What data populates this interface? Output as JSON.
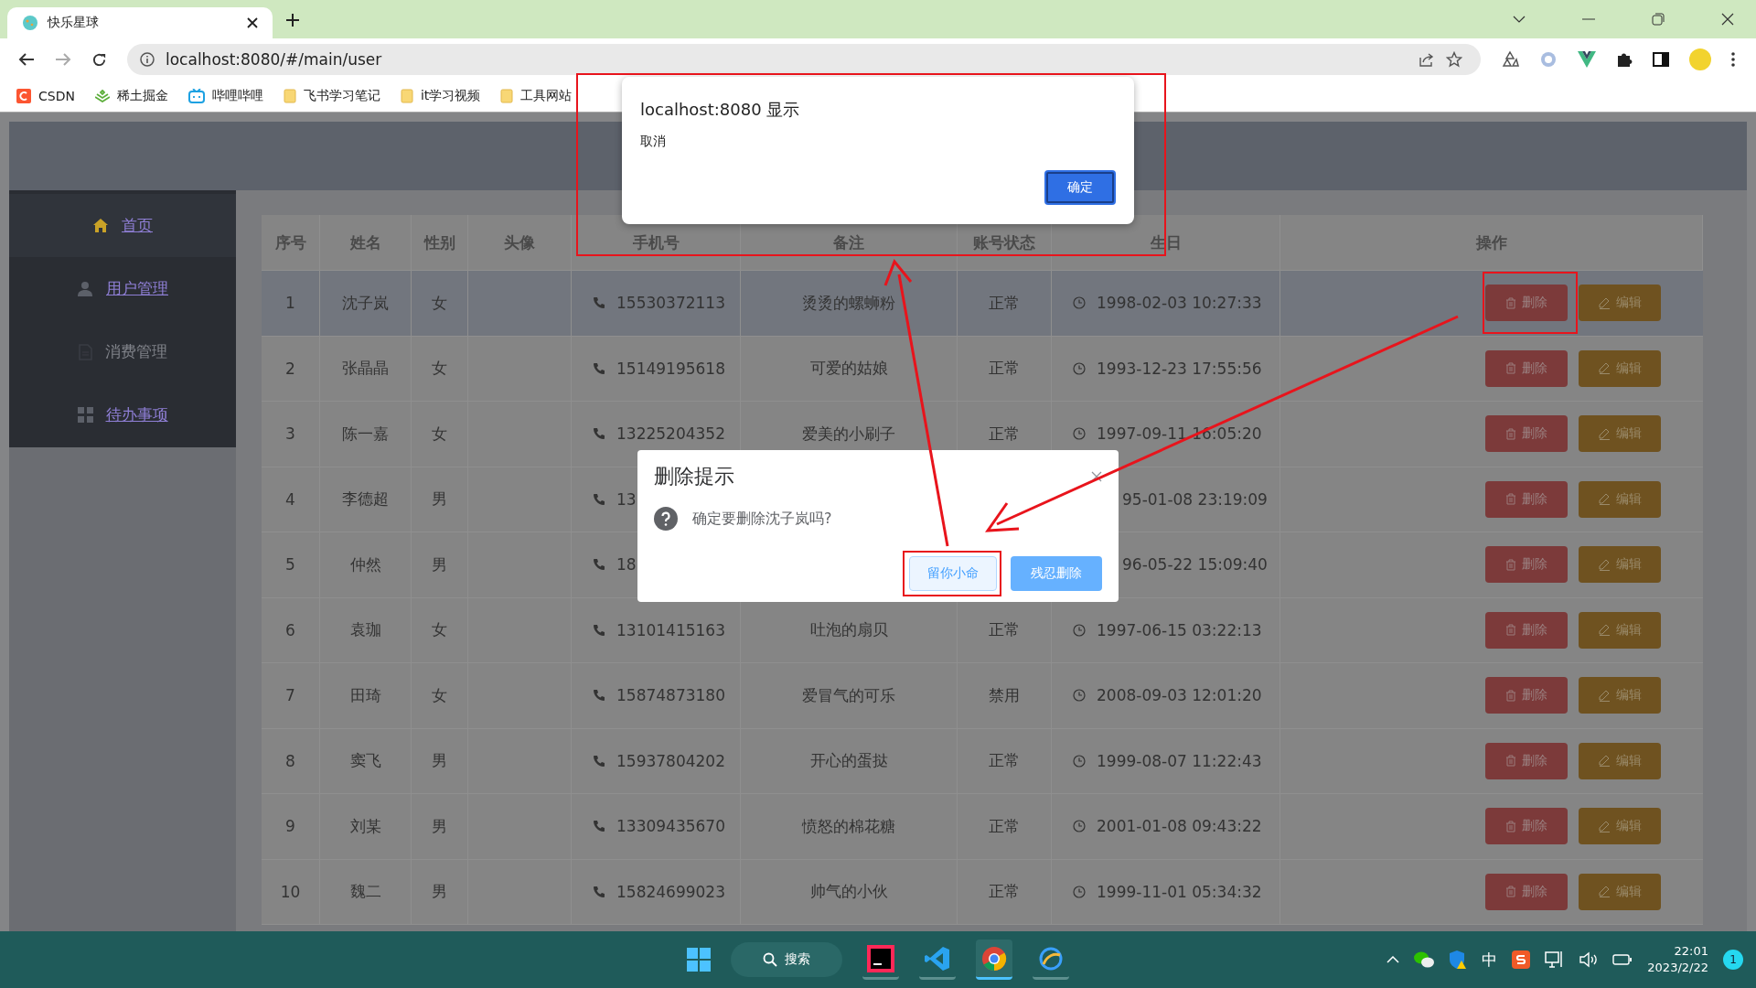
{
  "browser": {
    "tab_title": "快乐星球",
    "url": "localhost:8080/#/main/user"
  },
  "bookmarks": [
    {
      "label": "CSDN",
      "kind": "csdn"
    },
    {
      "label": "稀土掘金",
      "kind": "juejin"
    },
    {
      "label": "哔哩哔哩",
      "kind": "bilibili"
    },
    {
      "label": "飞书学习笔记",
      "kind": "folder"
    },
    {
      "label": "it学习视频",
      "kind": "folder"
    },
    {
      "label": "工具网站",
      "kind": "folder"
    }
  ],
  "sidebar": {
    "items": [
      {
        "label": "首页",
        "kind": "home",
        "selected": true,
        "disabled": false
      },
      {
        "label": "用户管理",
        "kind": "user",
        "selected": false,
        "disabled": false
      },
      {
        "label": "消费管理",
        "kind": "document",
        "selected": false,
        "disabled": true
      },
      {
        "label": "待办事项",
        "kind": "grid",
        "selected": false,
        "disabled": false
      }
    ]
  },
  "table": {
    "columns": [
      "序号",
      "姓名",
      "性别",
      "头像",
      "手机号",
      "备注",
      "账号状态",
      "生日",
      "操作"
    ],
    "rows": [
      {
        "index": "1",
        "name": "沈子岚",
        "gender": "女",
        "phone": "15530372113",
        "note": "烫烫的螺蛳粉",
        "status": "正常",
        "birthday": "1998-02-03 10:27:33",
        "highlighted": true,
        "covered": false,
        "delete_label": "删除",
        "edit_label": "编辑"
      },
      {
        "index": "2",
        "name": "张晶晶",
        "gender": "女",
        "phone": "15149195618",
        "note": "可爱的姑娘",
        "status": "正常",
        "birthday": "1993-12-23 17:55:56",
        "highlighted": false,
        "covered": false,
        "delete_label": "删除",
        "edit_label": "编辑"
      },
      {
        "index": "3",
        "name": "陈一嘉",
        "gender": "女",
        "phone": "13225204352",
        "note": "爱美的小刷子",
        "status": "正常",
        "birthday": "1997-09-11 16:05:20",
        "highlighted": false,
        "covered": false,
        "delete_label": "删除",
        "edit_label": "编辑"
      },
      {
        "index": "4",
        "name": "李德超",
        "gender": "男",
        "phone": "13",
        "birthday": "95-01-08 23:19:09",
        "highlighted": false,
        "covered": true,
        "delete_label": "删除",
        "edit_label": "编辑"
      },
      {
        "index": "5",
        "name": "仲然",
        "gender": "男",
        "phone": "18",
        "birthday": "96-05-22 15:09:40",
        "highlighted": false,
        "covered": true,
        "delete_label": "删除",
        "edit_label": "编辑"
      },
      {
        "index": "6",
        "name": "袁珈",
        "gender": "女",
        "phone": "13101415163",
        "note": "吐泡的扇贝",
        "status": "正常",
        "birthday": "1997-06-15 03:22:13",
        "highlighted": false,
        "covered": false,
        "delete_label": "删除",
        "edit_label": "编辑"
      },
      {
        "index": "7",
        "name": "田琦",
        "gender": "女",
        "phone": "15874873180",
        "note": "爱冒气的可乐",
        "status": "禁用",
        "birthday": "2008-09-03 12:01:20",
        "highlighted": false,
        "covered": false,
        "delete_label": "删除",
        "edit_label": "编辑"
      },
      {
        "index": "8",
        "name": "窦飞",
        "gender": "男",
        "phone": "15937804202",
        "note": "开心的蛋挞",
        "status": "正常",
        "birthday": "1999-08-07 11:22:43",
        "highlighted": false,
        "covered": false,
        "delete_label": "删除",
        "edit_label": "编辑"
      },
      {
        "index": "9",
        "name": "刘某",
        "gender": "男",
        "phone": "13309435670",
        "note": "愤怒的棉花糖",
        "status": "正常",
        "birthday": "2001-01-08 09:43:22",
        "highlighted": false,
        "covered": false,
        "delete_label": "删除",
        "edit_label": "编辑"
      },
      {
        "index": "10",
        "name": "魏二",
        "gender": "男",
        "phone": "15824699023",
        "note": "帅气的小伙",
        "status": "正常",
        "birthday": "1999-11-01 05:34:32",
        "highlighted": false,
        "covered": false,
        "delete_label": "删除",
        "edit_label": "编辑"
      }
    ]
  },
  "alert": {
    "title": "localhost:8080 显示",
    "message": "取消",
    "ok": "确定"
  },
  "confirm": {
    "title": "删除提示",
    "message": "确定要删除沈子岚吗?",
    "cancel": "留你小命",
    "confirm": "残忍删除"
  },
  "taskbar": {
    "search": "搜索",
    "apps": [
      {
        "kind": "intellij",
        "selected": false
      },
      {
        "kind": "vscode",
        "selected": false
      },
      {
        "kind": "chrome",
        "selected": true
      },
      {
        "kind": "browser",
        "selected": false
      }
    ],
    "ime": "中",
    "time": "22:01",
    "date": "2023/2/22",
    "badge": "1"
  }
}
